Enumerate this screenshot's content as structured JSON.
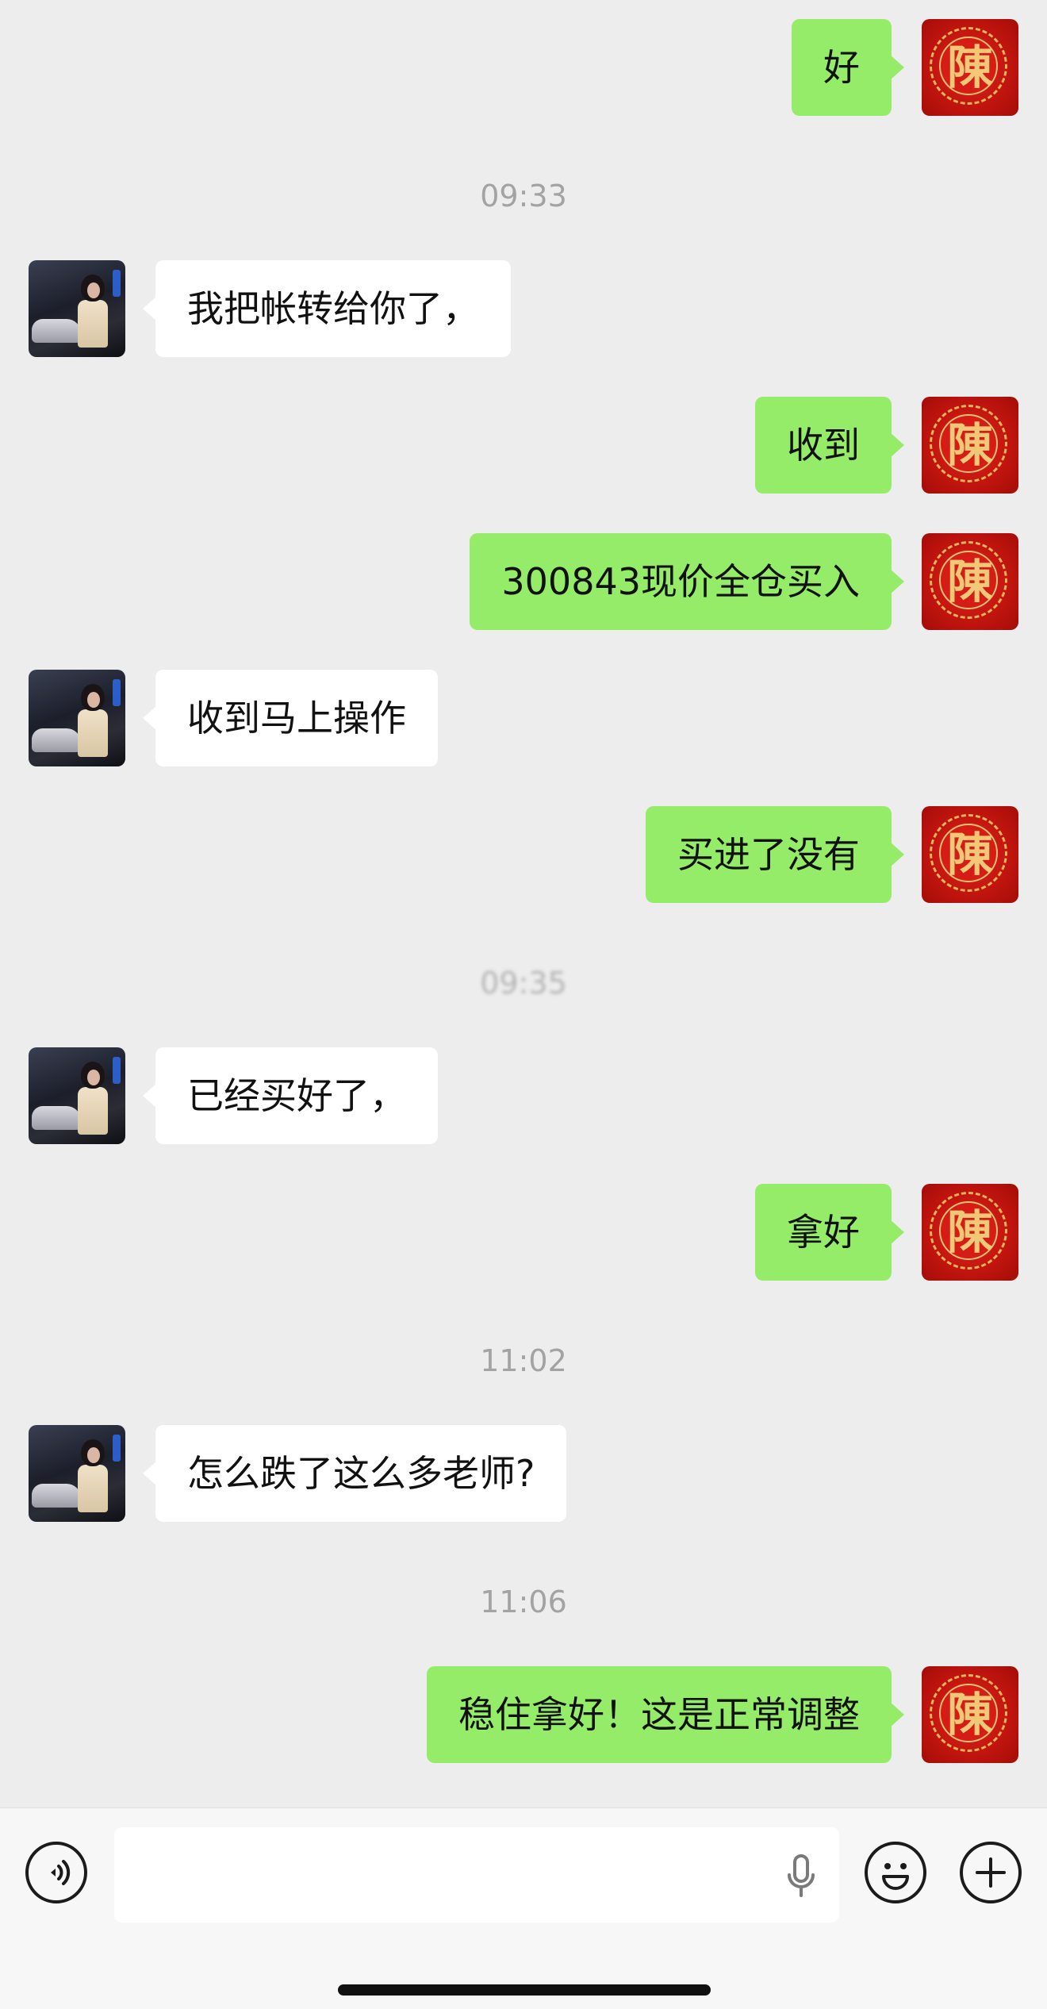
{
  "messages": [
    {
      "side": "out",
      "text": "好"
    },
    {
      "time": "09:33"
    },
    {
      "side": "in",
      "text": "我把帐转给你了，"
    },
    {
      "side": "out",
      "text": "收到"
    },
    {
      "side": "out",
      "text": "300843现价全仓买入"
    },
    {
      "side": "in",
      "text": "收到马上操作"
    },
    {
      "side": "out",
      "text": "买进了没有"
    },
    {
      "time": "09:35"
    },
    {
      "side": "in",
      "text": "已经买好了，"
    },
    {
      "side": "out",
      "text": "拿好"
    },
    {
      "time": "11:02"
    },
    {
      "side": "in",
      "text": "怎么跌了这么多老师?"
    },
    {
      "time": "11:06"
    },
    {
      "side": "out",
      "text": "稳住拿好！这是正常调整"
    }
  ],
  "self_avatar": {
    "char": "陳",
    "colors": {
      "background": "#c3150f",
      "ornament": "#e3b35a"
    }
  },
  "colors": {
    "outgoing_bubble": "#95ec69",
    "incoming_bubble": "#ffffff",
    "background": "#ededed"
  },
  "input_bar": {
    "icons": [
      "voice-icon",
      "microphone-icon",
      "emoji-icon",
      "plus-icon"
    ]
  }
}
